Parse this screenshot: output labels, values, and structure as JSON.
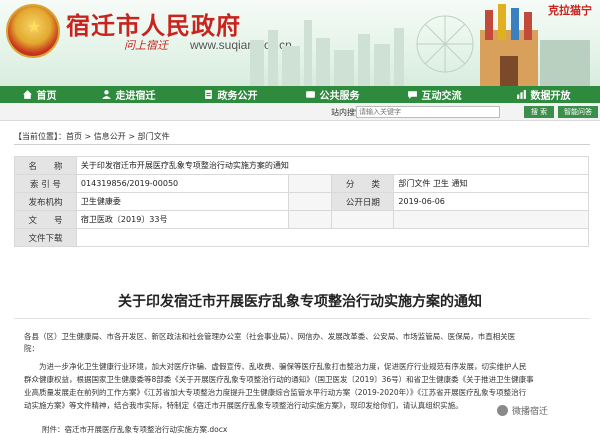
{
  "header": {
    "site_title": "宿迁市人民政府",
    "slogan": "问上宿迁",
    "site_url": "www.suqian.gov.cn",
    "right_slogan": "克拉猫宁"
  },
  "nav": [
    {
      "label": "首页",
      "icon": "home-icon"
    },
    {
      "label": "走进宿迁",
      "icon": "people-icon"
    },
    {
      "label": "政务公开",
      "icon": "document-icon"
    },
    {
      "label": "公共服务",
      "icon": "service-icon"
    },
    {
      "label": "互动交流",
      "icon": "chat-icon"
    },
    {
      "label": "数据开放",
      "icon": "data-icon"
    }
  ],
  "search": {
    "label": "站内搜索：",
    "placeholder": "请输入关键字",
    "button": "搜 索",
    "smart_button": "智能问答"
  },
  "breadcrumb": {
    "prefix": "【当前位置】：",
    "items": [
      "首页",
      "信息公开",
      "部门文件"
    ],
    "separator": " > "
  },
  "info": {
    "name_label": "名　　称",
    "name_value": "关于印发宿迁市开展医疗乱象专项整治行动实施方案的通知",
    "index_label": "索 引 号",
    "index_value": "014319856/2019-00050",
    "category_label": "分　　类",
    "category_value": "部门文件  卫生  通知",
    "org_label": "发布机构",
    "org_value": "卫生健康委",
    "date_label": "公开日期",
    "date_value": "2019-06-06",
    "docno_label": "文　　号",
    "docno_value": "宿卫医政〔2019〕33号",
    "validity_label": "文件下载",
    "validity_value": ""
  },
  "article": {
    "title": "关于印发宿迁市开展医疗乱象专项整治行动实施方案的通知",
    "lines": [
      "各县（区）卫生健康局、市各开发区、新区政法和社会管理办公室（社会事业局）、网信办、发展改革委、公安局、市场监管局、医保局，市直相关医",
      "院：",
      "　　为进一步净化卫生健康行业环境，加大对医疗诈骗、虚假宣传、乱收费、骗保等医疗乱象打击整治力度，促进医疗行业规范有序发展，切实维护人民",
      "群众健康权益，根据国家卫生健康委等8部委《关于开展医疗乱象专项整治行动的通知》（国卫医发〔2019〕36号）和省卫生健康委《关于推进卫生健康事",
      "业高质量发展走在前列的工作方案》《江苏省加大专项整治力度提升卫生健康综合监管水平行动方案（2019-2020年）》《江苏省开展医疗乱象专项整治行",
      "动实施方案》等文件精神，结合我市实际，特制定《宿迁市开展医疗乱象专项整治行动实施方案》，现印发给你们，请认真组织实施。"
    ],
    "attachment": "附件：宿迁市开展医疗乱象专项整治行动实施方案.docx"
  },
  "watermark": "微播宿迁",
  "colors": {
    "nav_green": "#2e8b3e",
    "title_red": "#c8231d"
  }
}
